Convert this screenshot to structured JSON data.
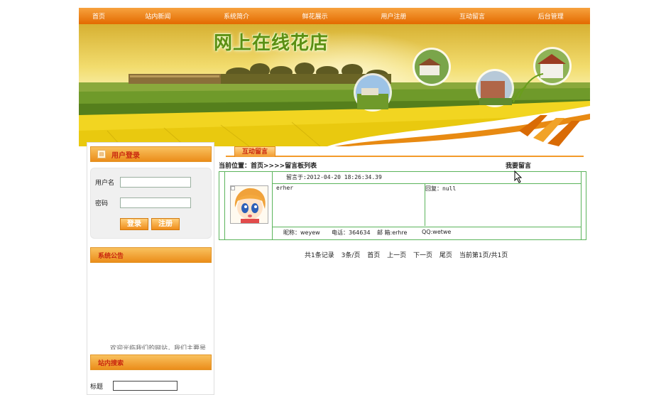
{
  "nav": {
    "items": [
      "首页",
      "站内新闻",
      "系统简介",
      "鲜花展示",
      "用户注册",
      "互动留言",
      "后台管理"
    ]
  },
  "banner": {
    "site_title": "网上在线花店"
  },
  "login": {
    "panel_title": "用户登录",
    "username_label": "用户名",
    "password_label": "密码",
    "login_button": "登录",
    "register_button": "注册"
  },
  "notice": {
    "panel_title": "系统公告",
    "scroll_text": "欢迎光临我们的网站，我们主要是"
  },
  "search": {
    "panel_title": "站内搜索",
    "title_label": "标题"
  },
  "main": {
    "tab_label": "互动留言",
    "breadcrumb": "当前位置：首页>>>>留言板列表",
    "write_link": "我要留言"
  },
  "message": {
    "posted_at": "留言于:2012-04-20 18:26:34.39",
    "content": "erher",
    "reply": "回复：null",
    "nickname": "昵称：weyew",
    "phone": "电话：364634",
    "email": "邮 箱:erhre",
    "qq": "QQ:wetwe"
  },
  "pagination": {
    "total": "共1条记录",
    "per_page": "3条/页",
    "first": "首页",
    "prev": "上一页",
    "next": "下一页",
    "last": "尾页",
    "current": "当前第1页/共1页"
  },
  "colors": {
    "nav_orange": "#e36a00",
    "panel_orange": "#eb8d1a",
    "table_green": "#5bb45b",
    "title_green": "#5c8f14",
    "heading_red": "#c9270f"
  }
}
